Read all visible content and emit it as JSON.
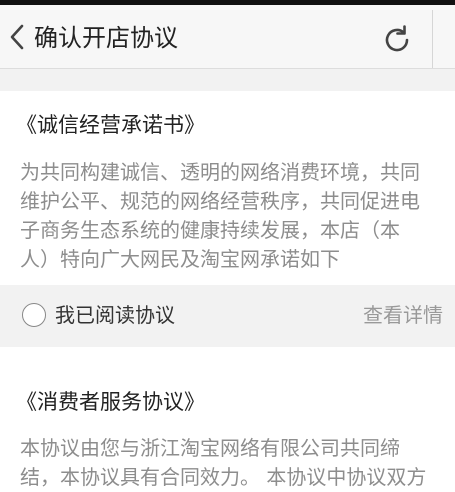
{
  "header": {
    "title": "确认开店协议",
    "back_icon": "chevron-left-icon",
    "refresh_icon": "refresh-icon"
  },
  "integrity": {
    "title": "《诚信经营承诺书》",
    "lines": [
      "为共同构建诚信、透明的网络消费环境，共同",
      "维护公平、规范的网络经营秩序，共同促进电",
      "子商务生态系统的健康持续发展，本店（本",
      "人）特向广大网民及淘宝网承诺如下"
    ]
  },
  "agreement": {
    "checked": false,
    "label": "我已阅读协议",
    "details_label": "查看详情"
  },
  "consumer": {
    "title": "《消费者服务协议》",
    "lines": [
      "本协议由您与浙江淘宝网络有限公司共同缔",
      "结，本协议具有合同效力。 本协议中协议双方"
    ]
  },
  "colors": {
    "header_bg": "#f7f7f7",
    "section_gap": "#f2f2f2",
    "body_text": "#8d8d8d"
  }
}
